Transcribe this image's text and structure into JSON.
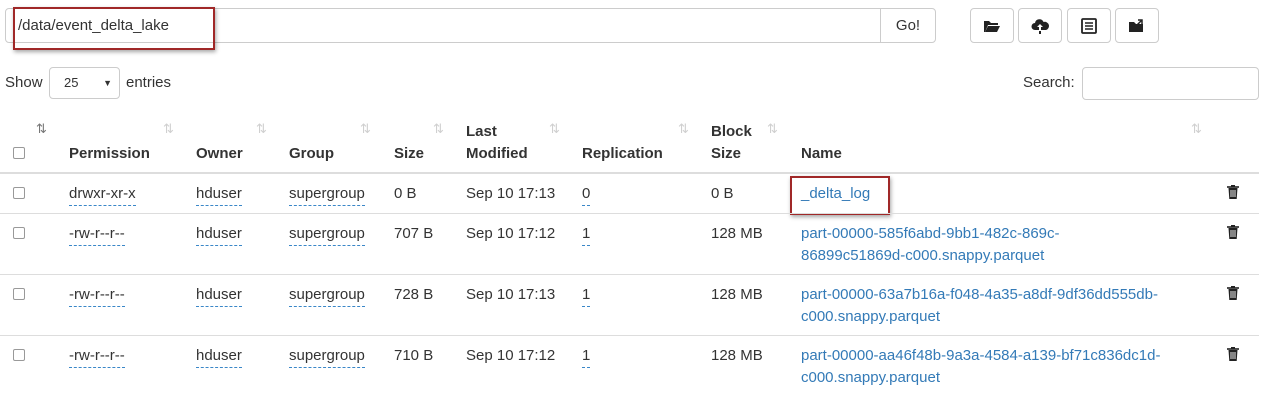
{
  "toolbar": {
    "path_value": "/data/event_delta_lake",
    "go_label": "Go!",
    "buttons": [
      "folder-open-icon",
      "cloud-upload-icon",
      "list-alt-icon",
      "folder-move-icon"
    ]
  },
  "length": {
    "show_label": "Show",
    "selected": "25",
    "entries_label": "entries"
  },
  "search": {
    "label": "Search:",
    "value": ""
  },
  "table": {
    "headers": {
      "permission": "Permission",
      "owner": "Owner",
      "group": "Group",
      "size": "Size",
      "last_modified_1": "Last",
      "last_modified_2": "Modified",
      "replication": "Replication",
      "block_size_1": "Block",
      "block_size_2": "Size",
      "name": "Name"
    },
    "rows": [
      {
        "permission": "drwxr-xr-x",
        "owner": "hduser",
        "group": "supergroup",
        "size": "0 B",
        "modified": "Sep 10 17:13",
        "replication": "0",
        "block_size": "0 B",
        "name_1": "_delta_log",
        "name_2": ""
      },
      {
        "permission": "-rw-r--r--",
        "owner": "hduser",
        "group": "supergroup",
        "size": "707 B",
        "modified": "Sep 10 17:12",
        "replication": "1",
        "block_size": "128 MB",
        "name_1": "part-00000-585f6abd-9bb1-482c-869c-",
        "name_2": "86899c51869d-c000.snappy.parquet"
      },
      {
        "permission": "-rw-r--r--",
        "owner": "hduser",
        "group": "supergroup",
        "size": "728 B",
        "modified": "Sep 10 17:13",
        "replication": "1",
        "block_size": "128 MB",
        "name_1": "part-00000-63a7b16a-f048-4a35-a8df-9df36dd555db-",
        "name_2": "c000.snappy.parquet"
      },
      {
        "permission": "-rw-r--r--",
        "owner": "hduser",
        "group": "supergroup",
        "size": "710 B",
        "modified": "Sep 10 17:12",
        "replication": "1",
        "block_size": "128 MB",
        "name_1": "part-00000-aa46f48b-9a3a-4584-a139-bf71c836dc1d-",
        "name_2": "c000.snappy.parquet"
      }
    ]
  },
  "colors": {
    "link": "#337ab7",
    "highlight": "#a02828",
    "border": "#dddddd"
  }
}
